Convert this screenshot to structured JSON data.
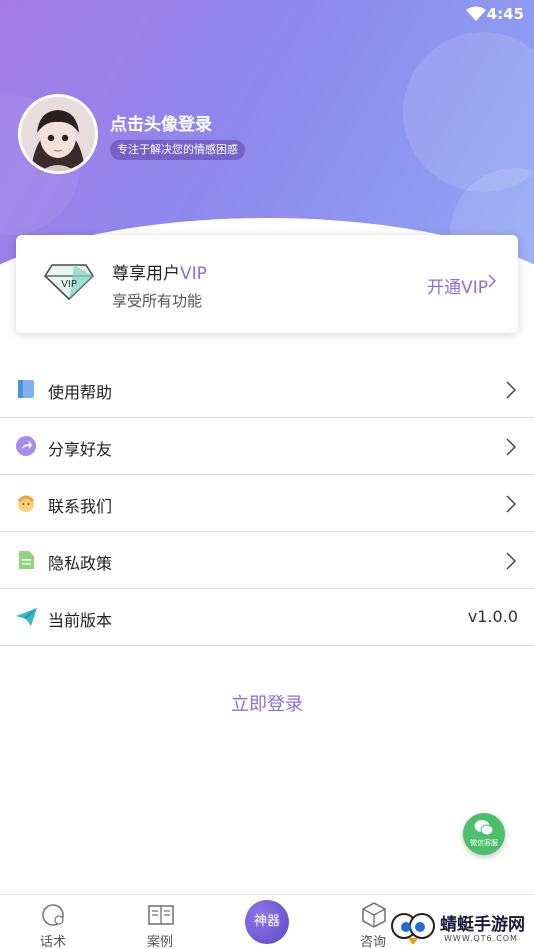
{
  "status_bar": {
    "time": "4:45"
  },
  "profile": {
    "login_title": "点击头像登录",
    "tagline": "专注于解决您的情感困惑"
  },
  "vip_card": {
    "title_prefix": "尊享用户",
    "title_vip": "VIP",
    "subtitle": "享受所有功能",
    "open_label": "开通VIP",
    "badge_text": "VIP"
  },
  "menu": {
    "items": [
      {
        "label": "使用帮助",
        "icon": "book-icon"
      },
      {
        "label": "分享好友",
        "icon": "share-icon"
      },
      {
        "label": "联系我们",
        "icon": "contact-icon"
      },
      {
        "label": "隐私政策",
        "icon": "document-icon"
      },
      {
        "label": "当前版本",
        "icon": "paper-plane-icon",
        "value": "v1.0.0"
      }
    ]
  },
  "login_button": "立即登录",
  "wechat_fab": {
    "label": "微信客服"
  },
  "tabbar": {
    "tabs": [
      {
        "label": "话术"
      },
      {
        "label": "案例"
      },
      {
        "label": "神器"
      },
      {
        "label": "咨询"
      }
    ]
  },
  "watermark": {
    "brand": "蜻蜓手游网",
    "url": "WWW.QT6.COM"
  },
  "colors": {
    "accent": "#8a6fd9",
    "header_start": "#a47be6",
    "header_end": "#8fa6f3",
    "wechat_green": "#4dbf6a"
  }
}
